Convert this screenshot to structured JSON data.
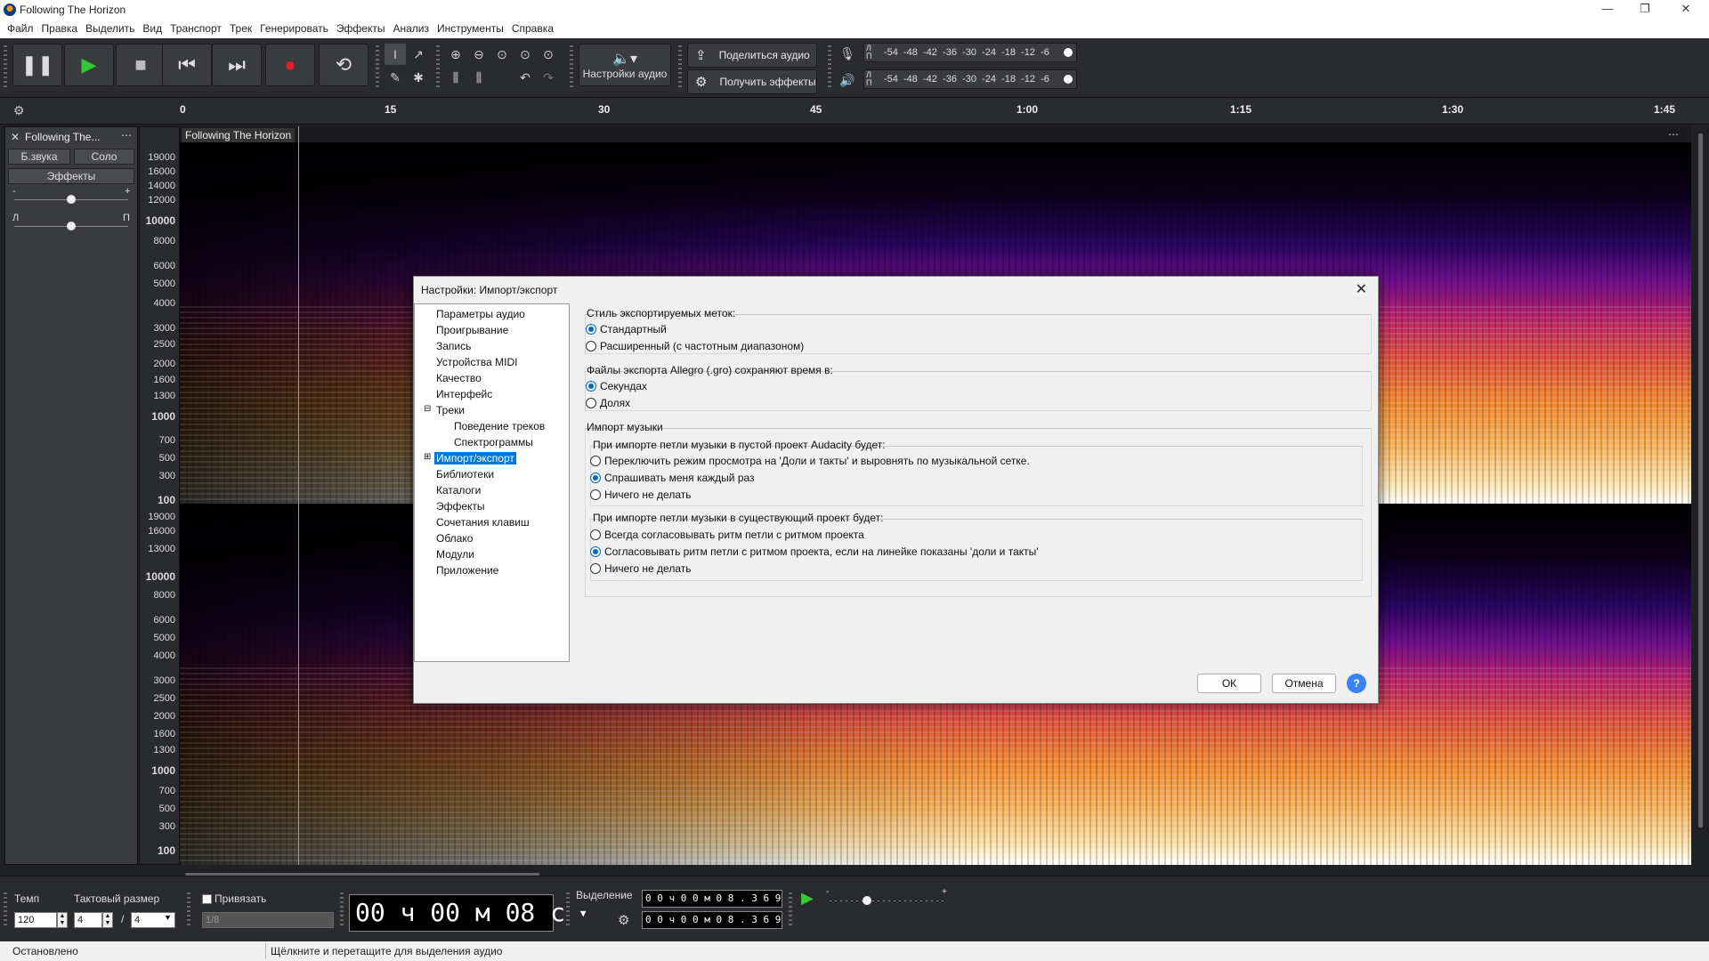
{
  "window": {
    "title": "Following The Horizon",
    "minimize": "—",
    "maximize": "❐",
    "close": "✕"
  },
  "menu": [
    "Файл",
    "Правка",
    "Выделить",
    "Вид",
    "Транспорт",
    "Трек",
    "Генерировать",
    "Эффекты",
    "Анализ",
    "Инструменты",
    "Справка"
  ],
  "toolbar": {
    "audio_setup": "Настройки аудио",
    "share_audio": "Поделиться аудио",
    "get_effects": "Получить эффекты",
    "meter_scale": "-54  -48  -42  -36  -30  -24  -18  -12  -6",
    "meter_l": "Л",
    "meter_r": "П"
  },
  "ruler": {
    "ticks": [
      "0",
      "15",
      "30",
      "45",
      "1:00",
      "1:15",
      "1:30",
      "1:45"
    ]
  },
  "track": {
    "name": "Following The...",
    "name_full": "Following The Horizon",
    "mute": "Б.звука",
    "solo": "Соло",
    "effects": "Эффекты",
    "gain_minus": "-",
    "gain_plus": "+",
    "pan_l": "Л",
    "pan_r": "П",
    "menu_icon": "⋯",
    "close_icon": "✕"
  },
  "freq_labels_top": [
    "19000",
    "16000",
    "14000",
    "12000",
    "10000",
    "8000",
    "6000",
    "5000",
    "4000",
    "3000",
    "2500",
    "2000",
    "1600",
    "1300",
    "1000",
    "700",
    "500",
    "300",
    "100"
  ],
  "freq_labels_bottom": [
    "19000",
    "16000",
    "13000",
    "10000",
    "8000",
    "6000",
    "5000",
    "4000",
    "3000",
    "2500",
    "2000",
    "1600",
    "1300",
    "1000",
    "700",
    "500",
    "300",
    "100"
  ],
  "dialog": {
    "title": "Настройки:  Импорт/экспорт",
    "tree": [
      "Параметры аудио",
      "Проигрывание",
      "Запись",
      "Устройства MIDI",
      "Качество",
      "Интерфейс",
      "Треки",
      "Поведение треков",
      "Спектрограммы",
      "Импорт/экспорт",
      "Библиотеки",
      "Каталоги",
      "Эффекты",
      "Сочетания клавиш",
      "Облако",
      "Модули",
      "Приложение"
    ],
    "label_style_title": "Стиль экспортируемых меток:",
    "label_style_opts": [
      "Стандартный",
      "Расширенный (с частотным диапазоном)"
    ],
    "allegro_title": "Файлы экспорта Allegro (.gro) сохраняют время в:",
    "allegro_opts": [
      "Секундах",
      "Долях"
    ],
    "music_import_title": "Импорт музыки",
    "empty_project_title": "При импорте петли музыки в пустой проект Audacity будет:",
    "empty_project_opts": [
      "Переключить режим просмотра на 'Доли и такты' и выровнять по музыкальной сетке.",
      "Спрашивать меня каждый раз",
      "Ничего не делать"
    ],
    "existing_project_title": "При импорте петли музыки в существующий проект будет:",
    "existing_project_opts": [
      "Всегда согласовывать ритм петли с ритмом проекта",
      "Согласовывать ритм петли с ритмом проекта, если на линейке показаны 'доли и такты'",
      "Ничего не делать"
    ],
    "ok": "ОК",
    "cancel": "Отмена",
    "help": "?"
  },
  "bottom": {
    "tempo_label": "Темп",
    "tempo": "120",
    "time_sig_label": "Тактовый размер",
    "ts_num": "4",
    "ts_slash": "/",
    "ts_den": "4",
    "snap_label": "Привязать",
    "snap_value": "1/8",
    "big_time": "00 ч 00 м 08 с",
    "selection_label": "Выделение",
    "sel_start": "0 0 ч 0 0 м 0 8 . 3 6 9 с",
    "sel_end": "0 0 ч 0 0 м 0 8 . 3 6 9 с"
  },
  "status": {
    "left": "Остановлено",
    "hint": "Щёлкните и перетащите для выделения аудио"
  }
}
